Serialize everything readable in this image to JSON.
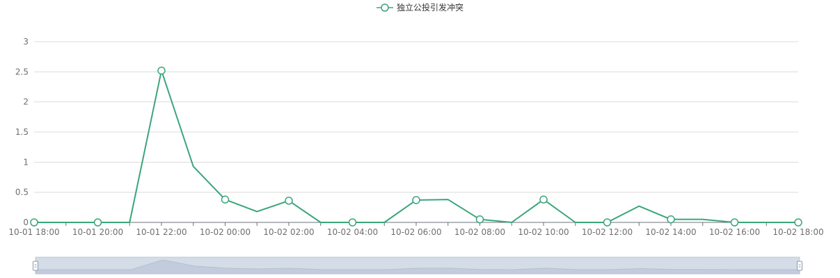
{
  "chart_data": {
    "type": "line",
    "title": "",
    "xlabel": "",
    "ylabel": "",
    "legend_position": "top-center",
    "grid": true,
    "ylim": [
      0,
      3
    ],
    "y_ticks": [
      "0",
      "0.5",
      "1",
      "1.5",
      "2",
      "2.5",
      "3"
    ],
    "x_tick_labels": [
      "10-01 18:00",
      "10-01 20:00",
      "10-01 22:00",
      "10-02 00:00",
      "10-02 02:00",
      "10-02 04:00",
      "10-02 06:00",
      "10-02 08:00",
      "10-02 10:00",
      "10-02 12:00",
      "10-02 14:00",
      "10-02 16:00",
      "10-02 18:00"
    ],
    "x": [
      "10-01 18:00",
      "10-01 19:00",
      "10-01 20:00",
      "10-01 21:00",
      "10-01 22:00",
      "10-01 23:00",
      "10-02 00:00",
      "10-02 01:00",
      "10-02 02:00",
      "10-02 03:00",
      "10-02 04:00",
      "10-02 05:00",
      "10-02 06:00",
      "10-02 07:00",
      "10-02 08:00",
      "10-02 09:00",
      "10-02 10:00",
      "10-02 11:00",
      "10-02 12:00",
      "10-02 13:00",
      "10-02 14:00",
      "10-02 15:00",
      "10-02 16:00",
      "10-02 17:00",
      "10-02 18:00"
    ],
    "series": [
      {
        "name": "独立公投引发冲突",
        "color": "#3aa57a",
        "values": [
          0,
          0,
          0,
          0,
          2.52,
          0.93,
          0.38,
          0.18,
          0.36,
          0,
          0,
          0,
          0.37,
          0.38,
          0.05,
          0,
          0.38,
          0,
          0,
          0.27,
          0.05,
          0.05,
          0,
          0,
          0
        ]
      }
    ],
    "datazoom": {
      "start_percent": 0,
      "end_percent": 100
    }
  }
}
